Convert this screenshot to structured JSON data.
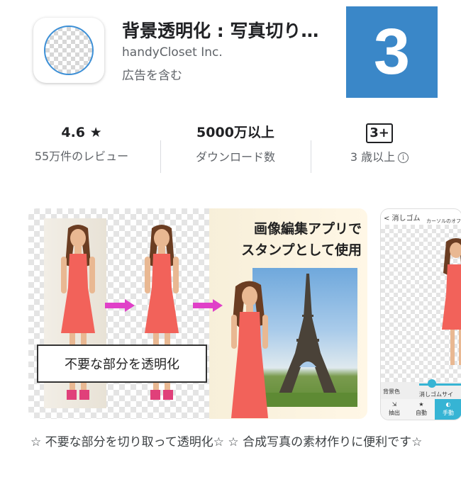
{
  "app": {
    "title": "背景透明化 : 写真切り…",
    "developer": "handyCloset Inc.",
    "ads_label": "広告を含む",
    "badge_number": "3"
  },
  "stats": {
    "rating_value": "4.6 ★",
    "rating_label": "55万件のレビュー",
    "downloads_value": "5000万以上",
    "downloads_label": "ダウンロード数",
    "age_value": "3+",
    "age_label": "3 歳以上",
    "info_glyph": "i"
  },
  "screenshot1": {
    "caption": "不要な部分を透明化",
    "promo_line1": "画像編集アプリで",
    "promo_line2": "スタンプとして使用"
  },
  "screenshot2": {
    "back_label": "< 消しゴム",
    "header_hint": "カーソルのオフ",
    "bg_label": "背景色",
    "size_label": "消しゴムサイ",
    "tab_extract": "抽出",
    "tab_auto": "自動",
    "tab_manual": "手動"
  },
  "description": "☆ 不要な部分を切り取って透明化☆ ☆ 合成写真の素材作りに便利です☆",
  "colors": {
    "badge_blue": "#3a87c8",
    "arrow_magenta": "#e040c8",
    "dress_coral": "#f2625a",
    "accent_cyan": "#36b4d4"
  }
}
